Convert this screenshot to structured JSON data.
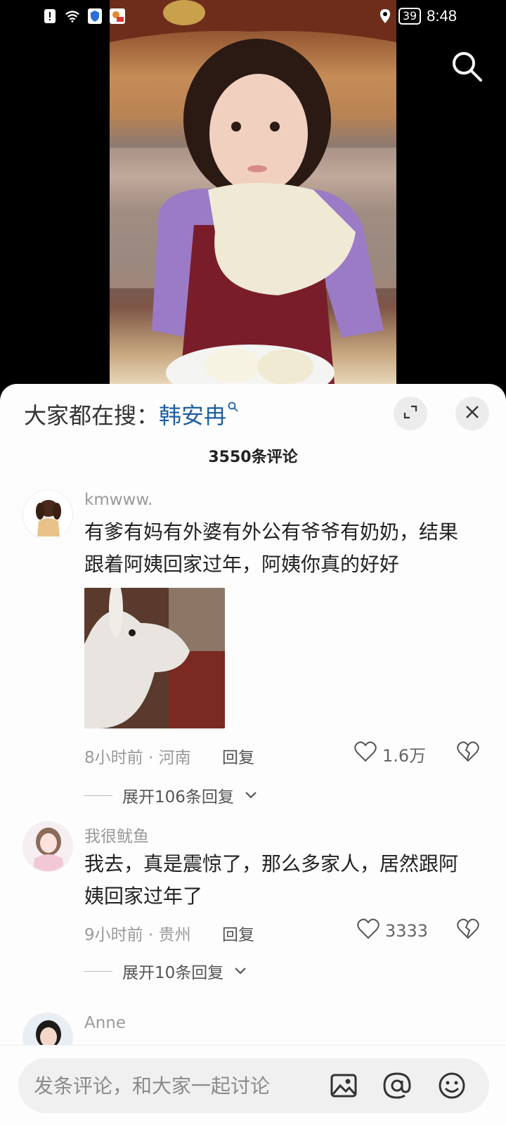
{
  "status_bar": {
    "time": "8:48",
    "battery": "39"
  },
  "sheet": {
    "search_prefix": "大家都在搜：",
    "search_keyword": "韩安冉",
    "comment_count": "3550条评论"
  },
  "comments": [
    {
      "user": "kmwww.",
      "text": "有爹有妈有外婆有外公有爷爷有奶奶，结果跟着阿姨回家过年，阿姨你真的好好",
      "meta": "8小时前 · 河南",
      "reply_label": "回复",
      "likes": "1.6万",
      "expand_label": "展开106条回复"
    },
    {
      "user": "我很鱿鱼",
      "text": "我去，真是震惊了，那么多家人，居然跟阿姨回家过年了",
      "meta": "9小时前 · 贵州",
      "reply_label": "回复",
      "likes": "3333",
      "expand_label": "展开10条回复"
    },
    {
      "user": "Anne"
    }
  ],
  "input": {
    "placeholder": "发条评论，和大家一起讨论"
  },
  "icons": {
    "search": "search-icon",
    "expand": "expand-icon",
    "close": "close-icon",
    "heart": "heart-icon",
    "dislike": "broken-heart-icon",
    "chevron": "chevron-down-icon",
    "image": "image-icon",
    "mention": "at-icon",
    "emoji": "emoji-icon"
  }
}
